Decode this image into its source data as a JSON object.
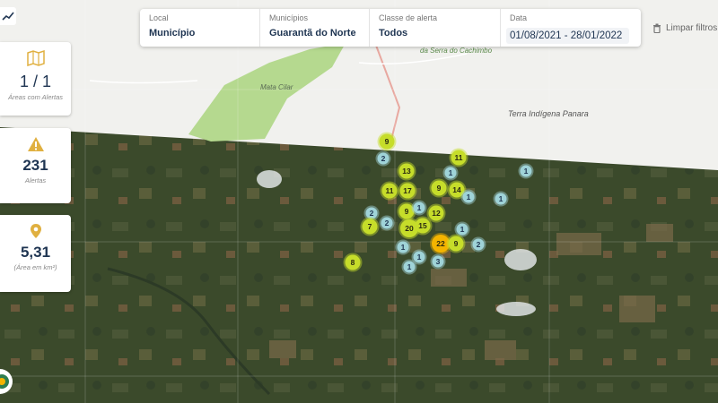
{
  "filters": {
    "local": {
      "label": "Local",
      "value": "Município"
    },
    "municipios": {
      "label": "Municípios",
      "value": "Guarantã do Norte"
    },
    "classe": {
      "label": "Classe de alerta",
      "value": "Todos"
    },
    "data": {
      "label": "Data",
      "value": "01/08/2021 - 28/01/2022"
    },
    "clear_label": "Limpar filtros"
  },
  "stats": {
    "areas": {
      "value": "1 / 1",
      "caption": "Áreas com Alertas",
      "icon": "map-icon"
    },
    "alertas": {
      "value": "231",
      "caption": "Alertas",
      "icon": "warning-icon"
    },
    "area_km2": {
      "value": "5,31",
      "caption": "(Área em km²)",
      "icon": "location-pin-icon"
    }
  },
  "map_labels": {
    "serra": "da Serra do Cachimbo",
    "mata": "Mata Cilar",
    "terra": "Terra Indígena Panara"
  },
  "colors": {
    "cluster_yellow": "#c6dd2a",
    "cluster_blue": "#9fd3d8",
    "cluster_orange": "#f4b400",
    "protected_green": "#b5d98f",
    "accent_text": "#1f3552"
  },
  "clusters": [
    {
      "n": "9",
      "c": "yellow"
    },
    {
      "n": "2",
      "c": "blue"
    },
    {
      "n": "11",
      "c": "yellow"
    },
    {
      "n": "13",
      "c": "yellow"
    },
    {
      "n": "1",
      "c": "blue"
    },
    {
      "n": "1",
      "c": "blue"
    },
    {
      "n": "11",
      "c": "yellow"
    },
    {
      "n": "17",
      "c": "yellow"
    },
    {
      "n": "9",
      "c": "yellow"
    },
    {
      "n": "14",
      "c": "yellow"
    },
    {
      "n": "1",
      "c": "blue"
    },
    {
      "n": "1",
      "c": "blue"
    },
    {
      "n": "9",
      "c": "yellow"
    },
    {
      "n": "1",
      "c": "blue"
    },
    {
      "n": "12",
      "c": "yellow"
    },
    {
      "n": "2",
      "c": "blue"
    },
    {
      "n": "2",
      "c": "blue"
    },
    {
      "n": "7",
      "c": "yellow"
    },
    {
      "n": "20",
      "c": "yellow"
    },
    {
      "n": "15",
      "c": "yellow"
    },
    {
      "n": "1",
      "c": "blue"
    },
    {
      "n": "22",
      "c": "orange"
    },
    {
      "n": "9",
      "c": "yellow"
    },
    {
      "n": "2",
      "c": "blue"
    },
    {
      "n": "1",
      "c": "blue"
    },
    {
      "n": "1",
      "c": "blue"
    },
    {
      "n": "3",
      "c": "blue"
    },
    {
      "n": "1",
      "c": "blue"
    },
    {
      "n": "8",
      "c": "yellow"
    }
  ]
}
